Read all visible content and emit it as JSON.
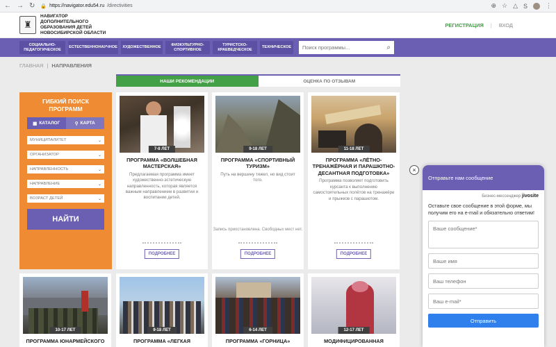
{
  "browser": {
    "url_host": "https://navigator.edu54.ru",
    "url_path": "/directivities"
  },
  "header": {
    "logo_text": "НАВИГАТОР ДОПОЛНИТЕЛЬНОГО ОБРАЗОВАНИЯ ДЕТЕЙ НОВОСИБИРСКОЙ ОБЛАСТИ",
    "register": "РЕГИСТРАЦИЯ",
    "login": "ВХОД"
  },
  "nav": {
    "categories": [
      "СОЦИАЛЬНО-ПЕДАГОГИЧЕСКОЕ",
      "ЕСТЕСТВЕННОНАУЧНОЕ",
      "ХУДОЖЕСТВЕННОЕ",
      "ФИЗКУЛЬТУРНО-СПОРТИВНОЕ",
      "ТУРИСТСКО-КРАЕВЕДЧЕСКОЕ",
      "ТЕХНИЧЕСКОЕ"
    ],
    "search_placeholder": "Поиск программы..."
  },
  "breadcrumb": {
    "home": "ГЛАВНАЯ",
    "current": "НАПРАВЛЕНИЯ"
  },
  "tabs": {
    "recommend": "НАШИ РЕКОМЕНДАЦИИ",
    "rating": "ОЦЕНКА ПО ОТЗЫВАМ"
  },
  "filter": {
    "title": "ГИБКИЙ ПОИСК ПРОГРАММ",
    "catalog": "КАТАЛОГ",
    "map": "КАРТА",
    "selects": [
      "МУНИЦИПАЛИТЕТ",
      "ОРГАНИЗАТОР",
      "НАПРАВЛЕННОСТЬ",
      "НАПРАВЛЕНИЕ",
      "ВОЗРАСТ ДЕТЕЙ"
    ],
    "find": "НАЙТИ"
  },
  "cards": [
    {
      "age": "7-8 ЛЕТ",
      "title": "ПРОГРАММА «ВОЛШЕБНАЯ МАСТЕРСКАЯ»",
      "desc": "Предлагаемая программа имеет художественно-эстетическую направленность, которая является важным направлением в развитии и воспитании детей.",
      "note": "",
      "more": "ПОДРОБНЕЕ"
    },
    {
      "age": "9-18 ЛЕТ",
      "title": "ПРОГРАММА «СПОРТИВНЫЙ ТУРИЗМ»",
      "desc": "Путь на вершину тяжел, но вид стоит того.",
      "note": "Запись приостановлена. Свободных мест нет.",
      "more": "ПОДРОБНЕЕ"
    },
    {
      "age": "11-18 ЛЕТ",
      "title": "ПРОГРАММА «ЛЁТНО-ТРЕНАЖЁРНАЯ И ПАРАШЮТНО-ДЕСАНТНАЯ ПОДГОТОВКА»",
      "desc": "Программа позволяет подготовить курсанта к выполнению самостоятельных полётов на тренажёре и прыжков с парашютом.",
      "note": "",
      "more": "ПОДРОБНЕЕ"
    },
    {
      "age": "10-17 ЛЕТ",
      "title": "ПРОГРАММА ЮНАРМЕЙСКОГО"
    },
    {
      "age": "9-18 ЛЕТ",
      "title": "ПРОГРАММА «ЛЕГКАЯ"
    },
    {
      "age": "6-14 ЛЕТ",
      "title": "ПРОГРАММА «ГОРНИЦА»"
    },
    {
      "age": "12-17 ЛЕТ",
      "title": "МОДИФИЦИРОВАННАЯ"
    }
  ],
  "chat": {
    "header": "Отправьте нам сообщение",
    "brand_prefix": "Бизнес-мессенджер",
    "brand": "jivosite",
    "body": "Оставьте свое сообщение в этой форме, мы получим его на e-mail и обязательно ответим!",
    "message_placeholder": "Ваше сообщение*",
    "name_placeholder": "Ваше имя",
    "phone_placeholder": "Ваш телефон",
    "email_placeholder": "Ваш e-mail*",
    "send": "Отправить"
  }
}
